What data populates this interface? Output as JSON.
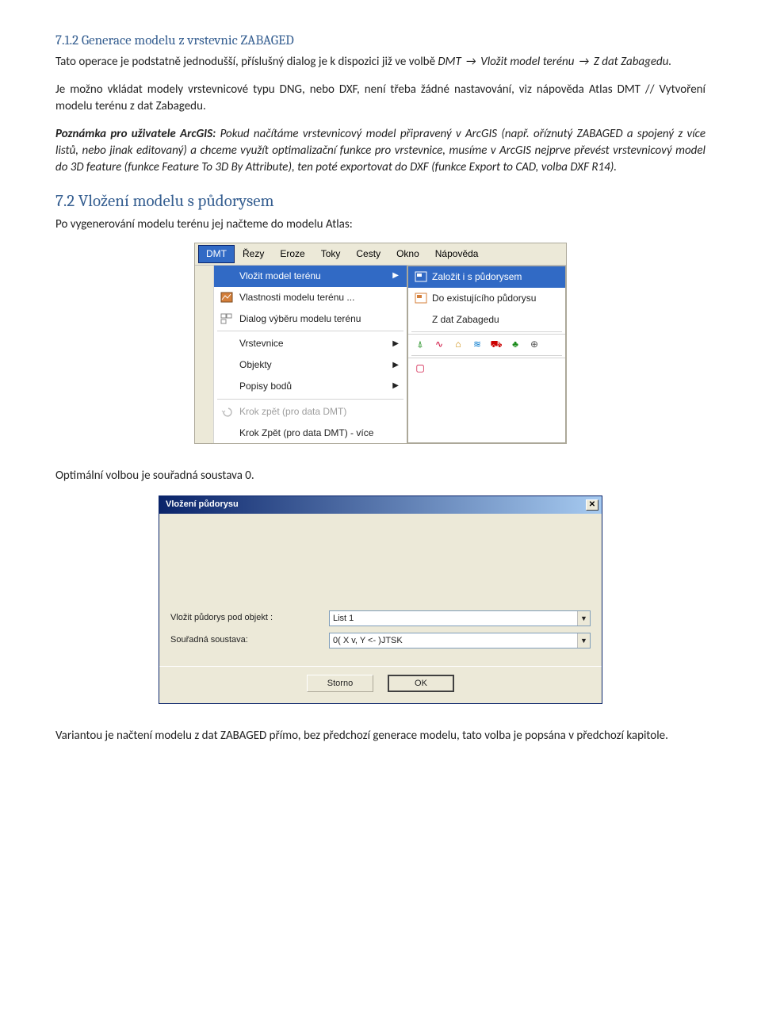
{
  "section712": {
    "heading": "7.1.2  Generace modelu z vrstevnic ZABAGED",
    "p1a": "Tato operace je podstatně jednodušší, příslušný dialog je k dispozici již ve volbě ",
    "p1b_i": "DMT ",
    "p1c_i": " Vložit model terénu ",
    "p1d_i": " Z dat Zabagedu.",
    "p2": "Je možno vkládat modely vrstevnicové typu DNG, nebo DXF, není třeba žádné nastavování, viz nápověda Atlas DMT // Vytvoření modelu terénu z dat Zabagedu.",
    "p3_lead": "Poznámka pro uživatele ArcGIS:",
    "p3_rest": " Pokud načítáme vrstevnicový model připravený v ArcGIS (např. oříznutý ZABAGED a spojený  z více listů, nebo jinak editovaný) a chceme využít optimalizační funkce pro vrstevnice, musíme v ArcGIS nejprve převést vrstevnicový model do 3D feature (funkce Feature To 3D By Attribute), ten poté exportovat do DXF (funkce Export to CAD, volba DXF R14)."
  },
  "section72": {
    "heading": "7.2  Vložení modelu s půdorysem",
    "intro": "Po vygenerování modelu terénu jej načteme do modelu Atlas:"
  },
  "menu": {
    "bar": [
      "DMT",
      "Řezy",
      "Eroze",
      "Toky",
      "Cesty",
      "Okno",
      "Nápověda"
    ],
    "items": [
      {
        "label": "Vložit model terénu",
        "hl": true,
        "arrow": true
      },
      {
        "label": "Vlastnosti modelu terénu ..."
      },
      {
        "label": "Dialog výběru modelu terénu"
      },
      {
        "label": "Vrstevnice",
        "arrow": true
      },
      {
        "label": "Objekty",
        "arrow": true
      },
      {
        "label": "Popisy bodů",
        "arrow": true
      },
      {
        "label": "Krok zpět (pro data DMT)",
        "disabled": true
      },
      {
        "label": "Krok Zpět (pro data DMT) - více"
      }
    ],
    "submenu": [
      {
        "label": "Založit i s půdorysem",
        "hl": true
      },
      {
        "label": "Do existujícího půdorysu"
      },
      {
        "label": "Z dat Zabagedu"
      }
    ]
  },
  "afterMenu": "Optimální volbou je souřadná soustava 0.",
  "dialog": {
    "title": "Vložení půdorysu",
    "row1_label": "Vložit půdorys pod objekt :",
    "row1_value": "List 1",
    "row2_label": "Souřadná soustava:",
    "row2_value": "0( X v,  Y <- )JTSK",
    "btn_cancel": "Storno",
    "btn_ok": "OK"
  },
  "tail": "Variantou je načtení modelu z dat ZABAGED přímo, bez předchozí generace modelu, tato volba je popsána v předchozí kapitole."
}
